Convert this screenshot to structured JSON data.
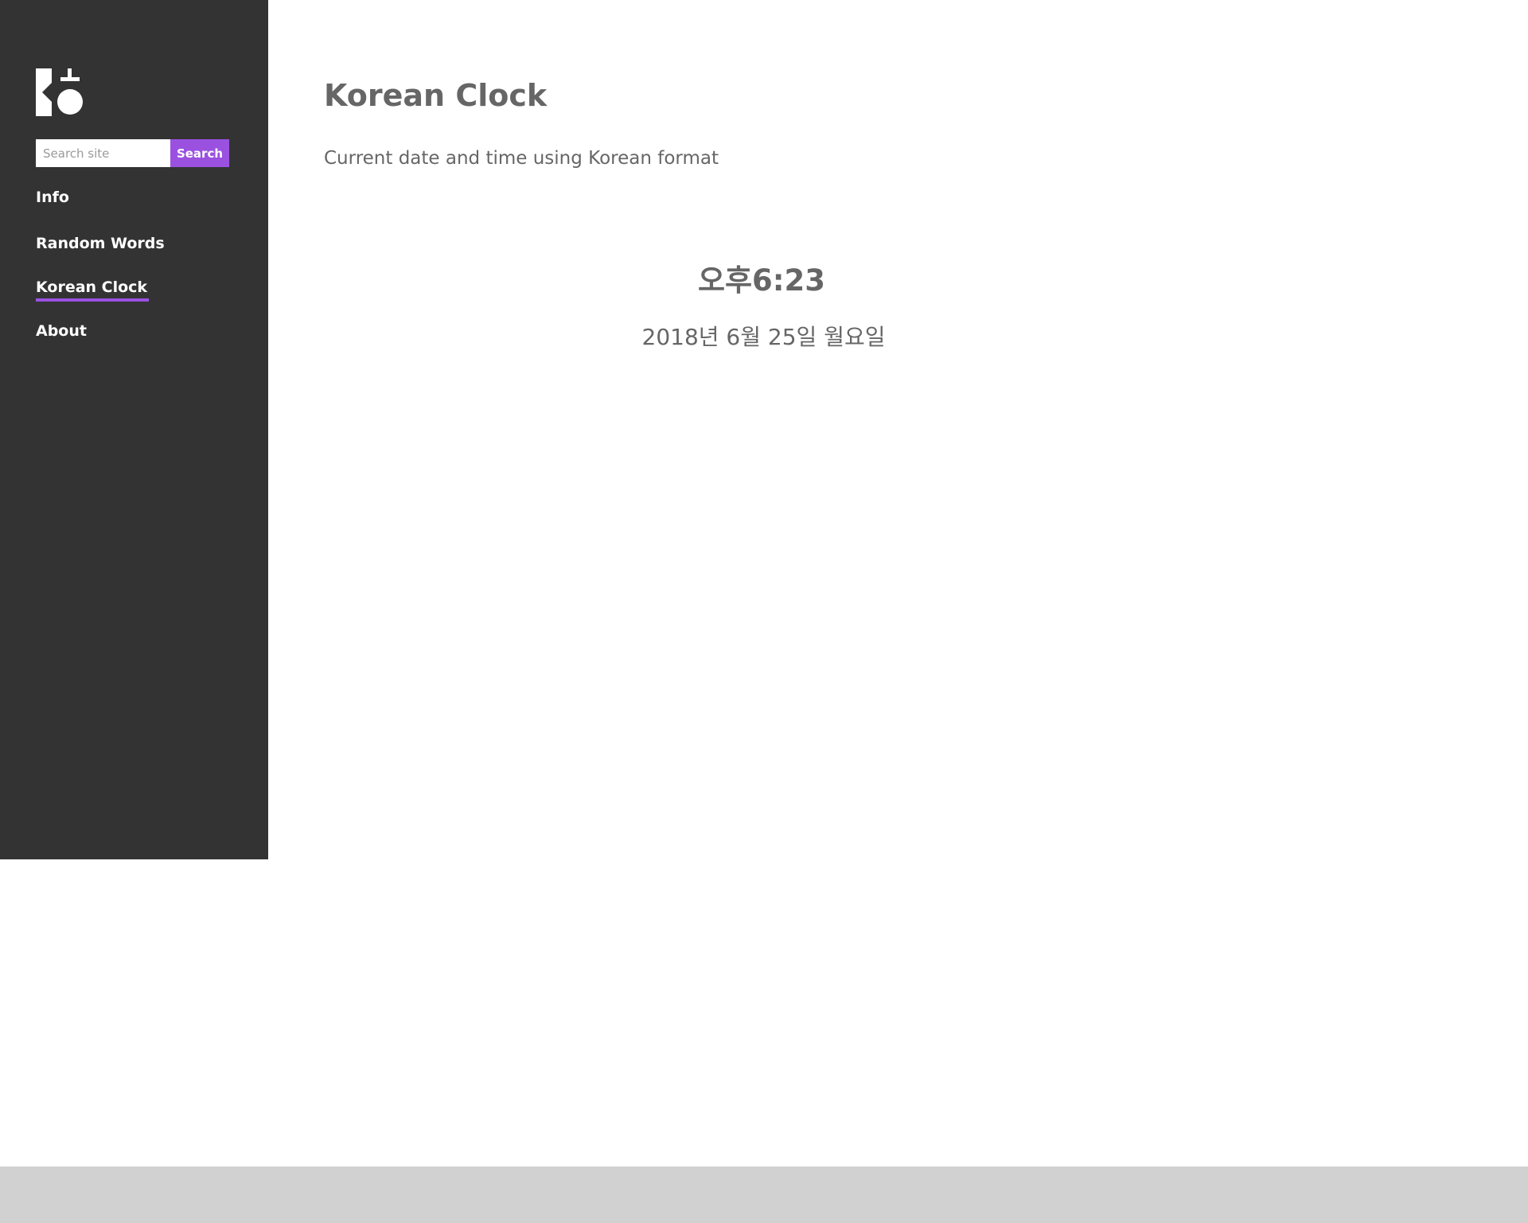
{
  "sidebar": {
    "logo_icon": "hangul-logo-icon",
    "search": {
      "placeholder": "Search site",
      "value": "",
      "button_label": "Search",
      "button_color": "#9b51e0"
    },
    "nav_items": [
      {
        "label": "Info",
        "active": false
      },
      {
        "label": "Random Words",
        "active": false
      },
      {
        "label": "Korean Clock",
        "active": true
      },
      {
        "label": "About",
        "active": false
      }
    ],
    "background_color": "#333333",
    "accent_color": "#9b51e0"
  },
  "main": {
    "title": "Korean Clock",
    "subtitle": "Current date and time using Korean format",
    "clock": {
      "time": "오후6:23",
      "date": "2018년 6월 25일 월요일"
    },
    "text_color": "#666666"
  },
  "footer": {
    "background_color": "#d1d1d1"
  }
}
